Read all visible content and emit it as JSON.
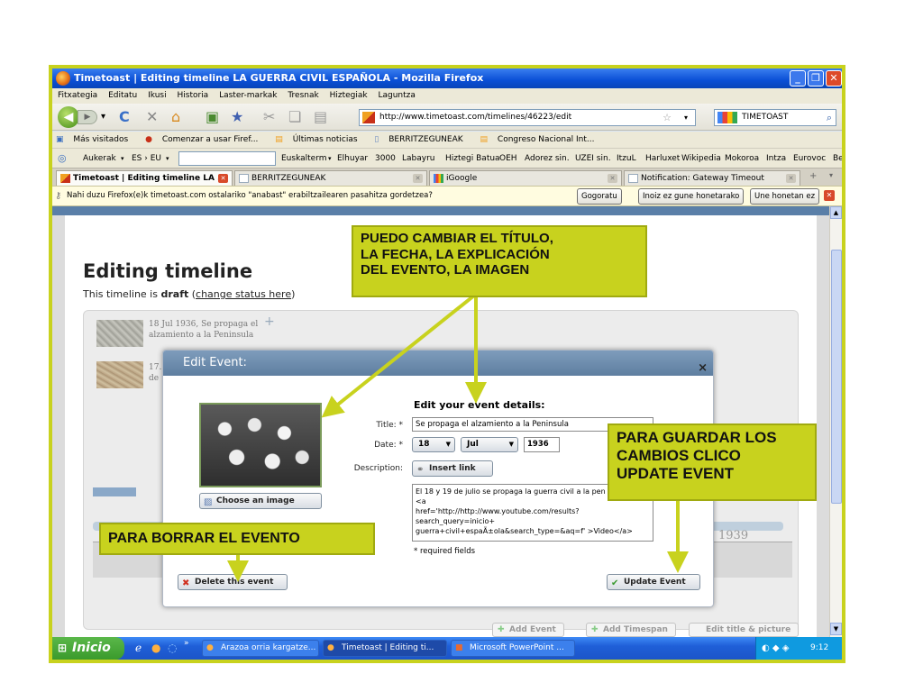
{
  "window": {
    "title": "Timetoast | Editing timeline LA GUERRA CIVIL ESPAÑOLA - Mozilla Firefox"
  },
  "menu": [
    "Fitxategia",
    "Editatu",
    "Ikusi",
    "Historia",
    "Laster-markak",
    "Tresnak",
    "Hiztegiak",
    "Laguntza"
  ],
  "navigation": {
    "url": "http://www.timetoast.com/timelines/46223/edit",
    "search_value": "TIMETOAST"
  },
  "bookmarks": [
    "Más visitados",
    "Comenzar a usar Firef...",
    "Últimas noticias",
    "BERRITZEGUNEAK",
    "Congreso Nacional Int..."
  ],
  "toolbar2": {
    "aukerak": "Aukerak",
    "lang": "ES › EU",
    "items": [
      "Euskalterm",
      "Elhuyar",
      "3000",
      "Labayru",
      "Hiztegi Batua",
      "OEH",
      "Adorez sin.",
      "UZEI sin.",
      "ItzuL",
      "Harluxet",
      "Wikipedia",
      "Mokoroa",
      "Intza",
      "Eurovoc",
      "Be"
    ]
  },
  "tabs": [
    {
      "label": "Timetoast | Editing timeline LA ...",
      "active": true
    },
    {
      "label": "BERRITZEGUNEAK",
      "active": false
    },
    {
      "label": "iGoogle",
      "active": false
    },
    {
      "label": "Notification: Gateway Timeout",
      "active": false
    }
  ],
  "notification": {
    "message": "Nahi duzu Firefox(e)k timetoast.com ostalariko \"anabast\" erabiltzailearen pasahitza gordetzea?",
    "buttons": [
      "Gogoratu",
      "Inoiz ez gune honetarako",
      "Une honetan ez"
    ]
  },
  "page": {
    "title": "Editing timeline",
    "subtitle_pre": "This timeline is ",
    "subtitle_status": "draft",
    "subtitle_link": "change status here",
    "subtitle_post": ")",
    "subtitle_open": " (",
    "timeline_items": [
      "18 Jul 1936, Se propaga el",
      "alzamiento a la Peninsula",
      "17.",
      "de"
    ],
    "year_label": "1939",
    "bottom_buttons": [
      "Add Event",
      "Add Timespan",
      "Edit title & picture"
    ]
  },
  "dialog": {
    "header": "Edit Event:",
    "close": "×",
    "section_title": "Edit your event details:",
    "title_label": "Title: *",
    "title_value": "Se propaga el alzamiento a la Peninsula",
    "date_label": "Date: *",
    "day": "18",
    "month": "Jul",
    "year": "1936",
    "description_label": "Description:",
    "insert_link": "Insert link",
    "description_value": "El 18 y 19 de julio se propaga la guerra civil a la pen\n<a\nhref='http://http://www.youtube.com/results?search_query=inicio+\nguerra+civil+espaÃ±ola&search_type=&aq=f' >Video</a>",
    "required_note": "* required fields",
    "choose_image": "Choose an image",
    "delete_event": "Delete this event",
    "update_event": "Update Event"
  },
  "callouts": {
    "top": "PUEDO CAMBIAR EL TÍTULO,\nLA FECHA, LA EXPLICACIÓN\nDEL EVENTO,  LA IMAGEN",
    "right": "PARA GUARDAR LOS\nCAMBIOS CLICO\nUPDATE EVENT",
    "left": "PARA BORRAR EL EVENTO"
  },
  "taskbar": {
    "start": "Inicio",
    "tasks": [
      "Arazoa orria kargatze...",
      "Timetoast | Editing ti...",
      "Microsoft PowerPoint ..."
    ],
    "time": "9:12"
  },
  "colors": {
    "callout": "#c8d21e",
    "arrow": "#c8d21e",
    "titlebar": "#0a4fd6",
    "dialog_header": "#6e8cae"
  }
}
